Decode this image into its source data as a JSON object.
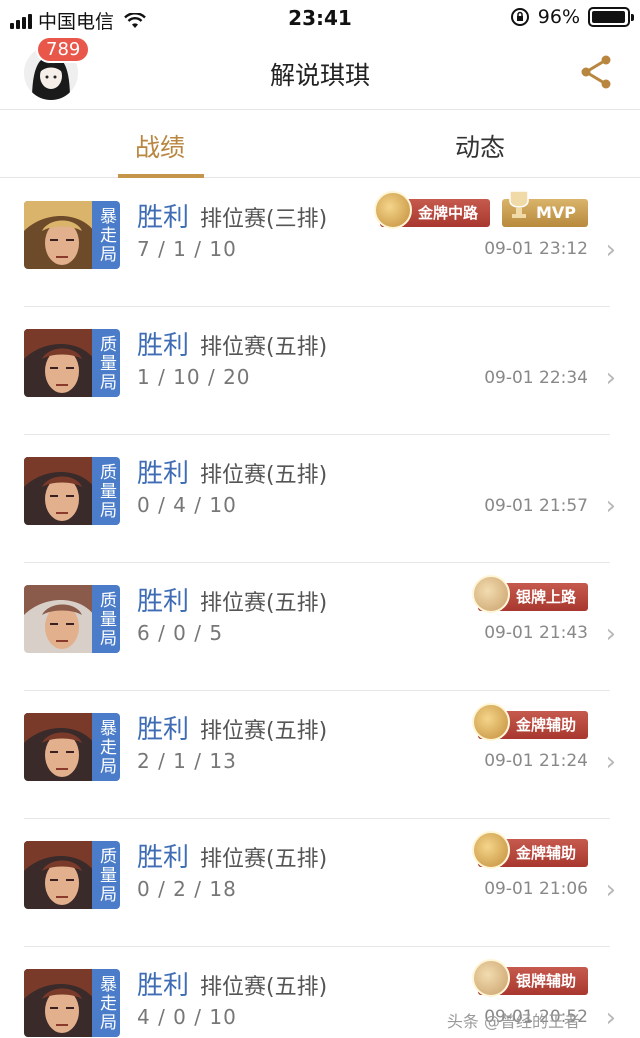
{
  "status_bar": {
    "carrier": "中国电信",
    "time": "23:41",
    "battery": "96%",
    "battery_level": 0.96
  },
  "header": {
    "badge_count": "789",
    "title": "解说琪琪",
    "share_icon": "share-icon",
    "avatar_icon": "avatar"
  },
  "tabs": [
    {
      "label": "战绩",
      "active": true
    },
    {
      "label": "动态",
      "active": false
    }
  ],
  "matches": [
    {
      "mode": "暴走局",
      "result": "胜利",
      "type": "排位赛(三排)",
      "kda": "7 / 1 / 10",
      "time": "09-01 23:12",
      "honors": [
        "金牌中路"
      ],
      "mvp": "MVP"
    },
    {
      "mode": "质量局",
      "result": "胜利",
      "type": "排位赛(五排)",
      "kda": "1 / 10 / 20",
      "time": "09-01 22:34",
      "honors": [],
      "mvp": ""
    },
    {
      "mode": "质量局",
      "result": "胜利",
      "type": "排位赛(五排)",
      "kda": "0 / 4 / 10",
      "time": "09-01 21:57",
      "honors": [],
      "mvp": ""
    },
    {
      "mode": "质量局",
      "result": "胜利",
      "type": "排位赛(五排)",
      "kda": "6 / 0 / 5",
      "time": "09-01 21:43",
      "honors": [
        "银牌上路"
      ],
      "mvp": ""
    },
    {
      "mode": "暴走局",
      "result": "胜利",
      "type": "排位赛(五排)",
      "kda": "2 / 1 / 13",
      "time": "09-01 21:24",
      "honors": [
        "金牌辅助"
      ],
      "mvp": ""
    },
    {
      "mode": "质量局",
      "result": "胜利",
      "type": "排位赛(五排)",
      "kda": "0 / 2 / 18",
      "time": "09-01 21:06",
      "honors": [
        "金牌辅助"
      ],
      "mvp": ""
    },
    {
      "mode": "暴走局",
      "result": "胜利",
      "type": "排位赛(五排)",
      "kda": "4 / 0 / 10",
      "time": "09-01 20:52",
      "honors": [
        "银牌辅助"
      ],
      "mvp": ""
    }
  ],
  "colors": {
    "accent": "#b8863f",
    "mode_tag": "#4a7cc9",
    "result": "#3f6db5",
    "honor": "#b8453a"
  },
  "watermark": "头条 @曾经的王者"
}
